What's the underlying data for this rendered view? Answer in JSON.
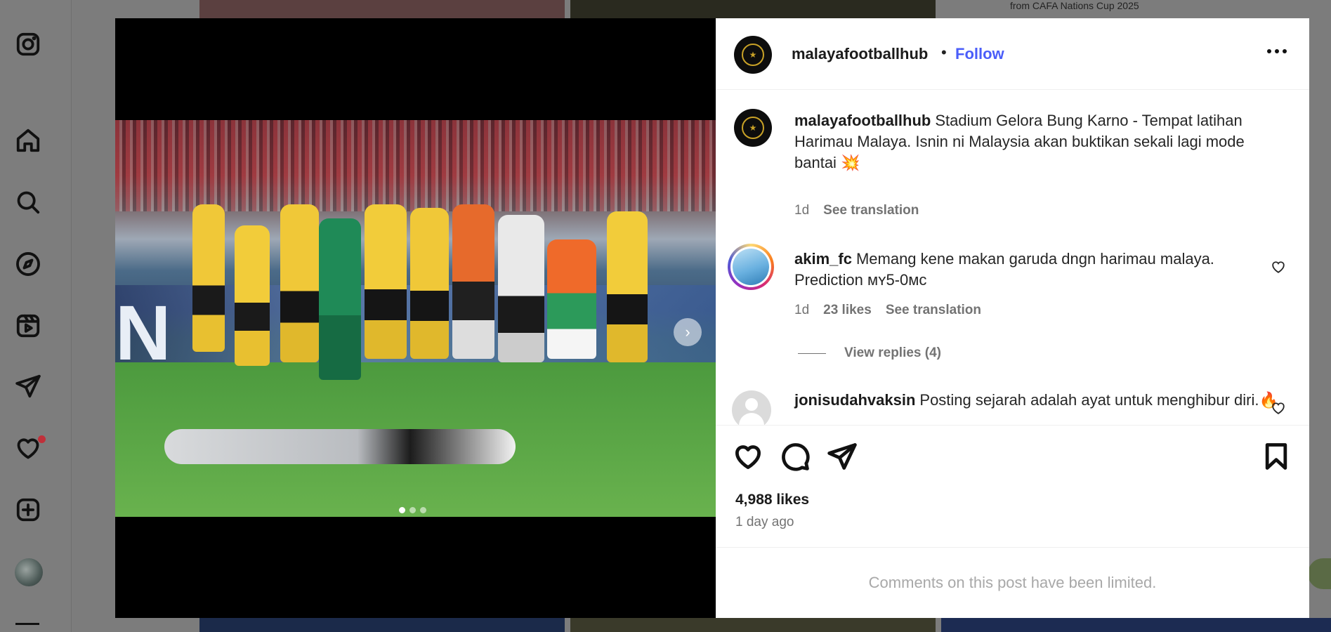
{
  "background": {
    "top_right_text": "from CAFA Nations Cup 2025"
  },
  "rail": {
    "icons": [
      "instagram-icon",
      "home-icon",
      "search-icon",
      "explore-icon",
      "reels-icon",
      "messages-icon",
      "notifications-icon",
      "create-icon",
      "profile-avatar",
      "more-icon"
    ]
  },
  "post": {
    "header": {
      "username": "malayafootballhub",
      "separator": "•",
      "follow_label": "Follow"
    },
    "banner_text": "N",
    "carousel": {
      "slides": 3,
      "active_index": 0
    },
    "caption": {
      "username": "malayafootballhub",
      "text": "Stadium Gelora Bung Karno - Tempat latihan Harimau Malaya. Isnin ni Malaysia akan buktikan sekali lagi mode bantai 💥",
      "time": "1d",
      "translate_label": "See translation"
    },
    "comments": [
      {
        "username": "akim_fc",
        "text": "Memang kene makan garuda dngn harimau malaya. Prediction ᴍʏ5-0ᴍᴄ",
        "time": "1d",
        "likes": "23 likes",
        "translate_label": "See translation",
        "view_replies": "View replies (4)"
      },
      {
        "username": "jonisudahvaksin",
        "text": "Posting sejarah adalah ayat untuk menghibur diri.🔥"
      }
    ],
    "likes_count": "4,988 likes",
    "posted_ago": "1 day ago",
    "comments_limited": "Comments on this post have been limited."
  }
}
